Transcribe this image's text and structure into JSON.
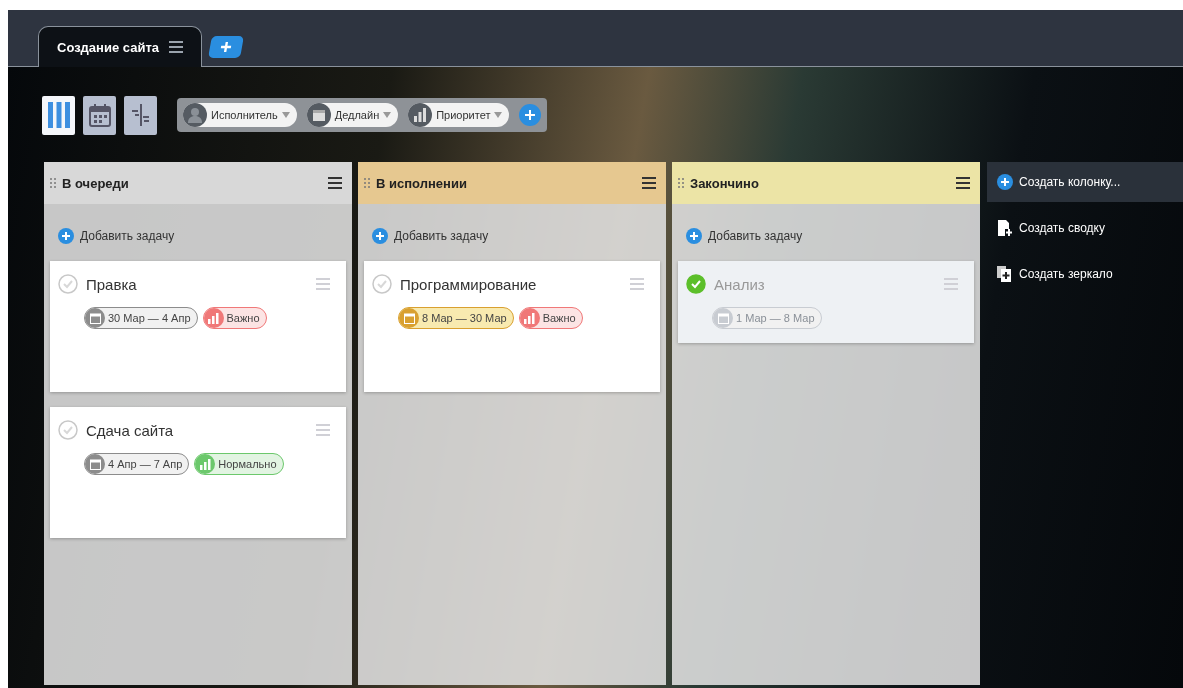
{
  "tab": {
    "title": "Создание сайта"
  },
  "views": [
    {
      "kind": "columns",
      "selected": true
    },
    {
      "kind": "calendar",
      "selected": false
    },
    {
      "kind": "timeline",
      "selected": false
    }
  ],
  "filters": [
    {
      "kind": "person",
      "label": "Исполнитель"
    },
    {
      "kind": "calendar",
      "label": "Дедлайн"
    },
    {
      "kind": "bars",
      "label": "Приоритет"
    }
  ],
  "columns": [
    {
      "title": "В очереди",
      "color": "#d8d8d8",
      "add_label": "Добавить задачу",
      "tasks": [
        {
          "title": "Правка",
          "done": false,
          "tags": [
            {
              "kind": "deadline",
              "label": "30 Мар — 4 Апр",
              "color": "#8c8c8c"
            },
            {
              "kind": "priority",
              "label": "Важно",
              "color": "#f07878"
            }
          ]
        },
        {
          "title": "Сдача сайта",
          "done": false,
          "tags": [
            {
              "kind": "deadline",
              "label": "4 Апр — 7 Апр",
              "color": "#8c8c8c"
            },
            {
              "kind": "priority",
              "label": "Нормально",
              "color": "#6cc86c"
            }
          ]
        }
      ]
    },
    {
      "title": "В исполнении",
      "color": "#e6c890",
      "add_label": "Добавить задачу",
      "tasks": [
        {
          "title": "Программирование",
          "done": false,
          "tags": [
            {
              "kind": "deadline",
              "label": "8 Мар — 30 Мар",
              "color": "#d9a030"
            },
            {
              "kind": "priority",
              "label": "Важно",
              "color": "#f07878"
            }
          ]
        }
      ]
    },
    {
      "title": "Закончино",
      "color": "#ece4a6",
      "add_label": "Добавить задачу",
      "tasks": [
        {
          "title": "Анализ",
          "done": true,
          "tags": [
            {
              "kind": "deadline",
              "label": "1 Мар — 8 Мар",
              "color": "#c8ccd2"
            }
          ]
        }
      ]
    }
  ],
  "actions": [
    {
      "kind": "column",
      "label": "Создать колонку...",
      "selected": true
    },
    {
      "kind": "summary",
      "label": "Создать сводку",
      "selected": false
    },
    {
      "kind": "mirror",
      "label": "Создать зеркало",
      "selected": false
    }
  ]
}
